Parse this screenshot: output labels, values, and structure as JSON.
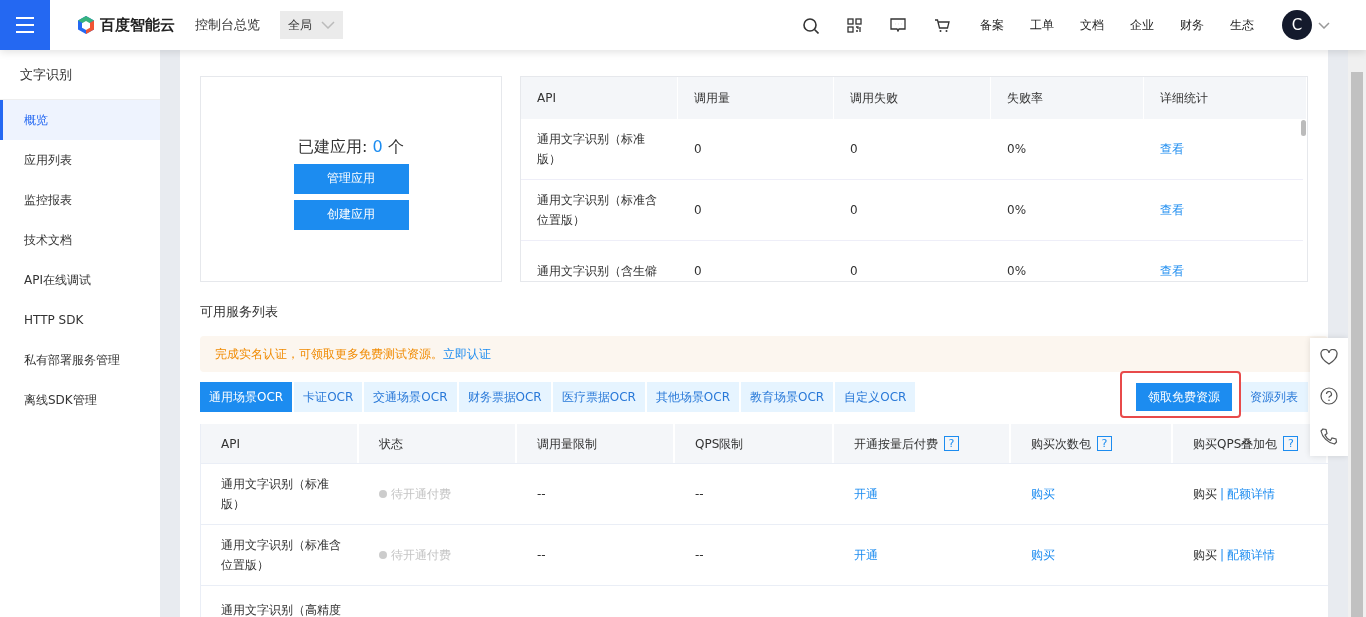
{
  "header": {
    "brand": "百度智能云",
    "overview": "控制台总览",
    "region": "全局",
    "nav": [
      "备案",
      "工单",
      "文档",
      "企业",
      "财务",
      "生态"
    ],
    "avatar": "C"
  },
  "sidebar": {
    "title": "文字识别",
    "items": [
      {
        "label": "概览",
        "selected": true
      },
      {
        "label": "应用列表",
        "selected": false
      },
      {
        "label": "监控报表",
        "selected": false
      },
      {
        "label": "技术文档",
        "selected": false
      },
      {
        "label": "API在线调试",
        "selected": false
      },
      {
        "label": "HTTP SDK",
        "selected": false
      },
      {
        "label": "私有部署服务管理",
        "selected": false
      },
      {
        "label": "离线SDK管理",
        "selected": false
      }
    ]
  },
  "apps": {
    "label": "已建应用:",
    "count": "0",
    "unit": "个",
    "buttons": [
      "管理应用",
      "创建应用"
    ]
  },
  "usage_table": {
    "columns": [
      "API",
      "调用量",
      "调用失败",
      "失败率",
      "详细统计"
    ],
    "rows": [
      {
        "api": "通用文字识别（标准版）",
        "calls": "0",
        "failed": "0",
        "rate": "0%",
        "link": "查看"
      },
      {
        "api": "通用文字识别（标准含位置版）",
        "calls": "0",
        "failed": "0",
        "rate": "0%",
        "link": "查看"
      },
      {
        "api": "通用文字识别（含生僻",
        "calls": "0",
        "failed": "0",
        "rate": "0%",
        "link": "查看"
      }
    ]
  },
  "services": {
    "title": "可用服务列表",
    "notice": "完成实名认证，可领取更多免费测试资源。",
    "notice_link": "立即认证",
    "tabs": [
      {
        "label": "通用场景OCR",
        "selected": true
      },
      {
        "label": "卡证OCR",
        "selected": false
      },
      {
        "label": "交通场景OCR",
        "selected": false
      },
      {
        "label": "财务票据OCR",
        "selected": false
      },
      {
        "label": "医疗票据OCR",
        "selected": false
      },
      {
        "label": "其他场景OCR",
        "selected": false
      },
      {
        "label": "教育场景OCR",
        "selected": false
      },
      {
        "label": "自定义OCR",
        "selected": false
      }
    ],
    "claim_button": "领取免费资源",
    "resource_list": "资源列表",
    "columns": [
      {
        "label": "API",
        "help": false
      },
      {
        "label": "状态",
        "help": false
      },
      {
        "label": "调用量限制",
        "help": false
      },
      {
        "label": "QPS限制",
        "help": false
      },
      {
        "label": "开通按量后付费",
        "help": true
      },
      {
        "label": "购买次数包",
        "help": true
      },
      {
        "label": "购买QPS叠加包",
        "help": true
      }
    ],
    "help_mark": "?",
    "rows": [
      {
        "api": "通用文字识别（标准版）",
        "status": "待开通付费",
        "call_limit": "--",
        "qps_limit": "--",
        "open": "开通",
        "buy": "购买",
        "qps_buy": "购买",
        "separator": "|",
        "quota": "配额详情"
      },
      {
        "api": "通用文字识别（标准含位置版）",
        "status": "待开通付费",
        "call_limit": "--",
        "qps_limit": "--",
        "open": "开通",
        "buy": "购买",
        "qps_buy": "购买",
        "separator": "|",
        "quota": "配额详情"
      },
      {
        "api": "通用文字识别（高精度"
      }
    ]
  }
}
